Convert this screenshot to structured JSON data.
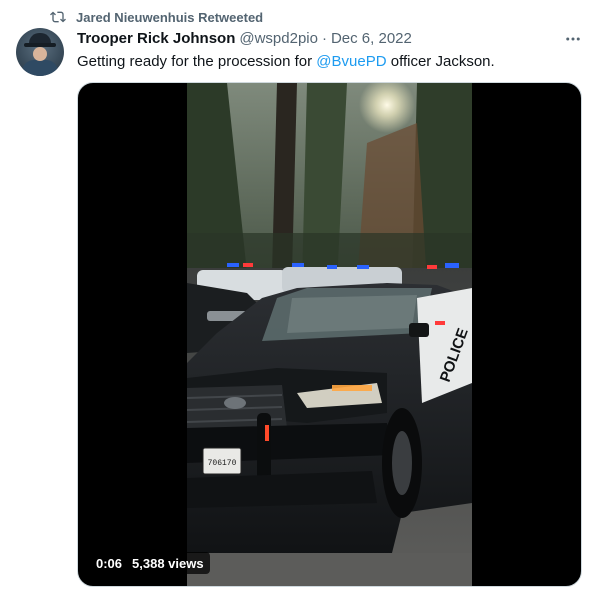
{
  "retweet": {
    "icon": "retweet-icon",
    "text": "Jared Nieuwenhuis Retweeted"
  },
  "tweet": {
    "author_name": "Trooper Rick Johnson",
    "handle": "@wspd2pio",
    "separator": "·",
    "date": "Dec 6, 2022",
    "text_before": "Getting ready for the procession for ",
    "mention": "@BvuePD",
    "text_after": " officer Jackson.",
    "more_icon": "more-horizontal-icon"
  },
  "media": {
    "duration": "0:06",
    "views": "5,388 views",
    "plate_text": "706170",
    "vehicle_label": "POLICE"
  },
  "colors": {
    "text": "#0f1419",
    "secondary": "#536471",
    "link": "#1d9bf0"
  }
}
